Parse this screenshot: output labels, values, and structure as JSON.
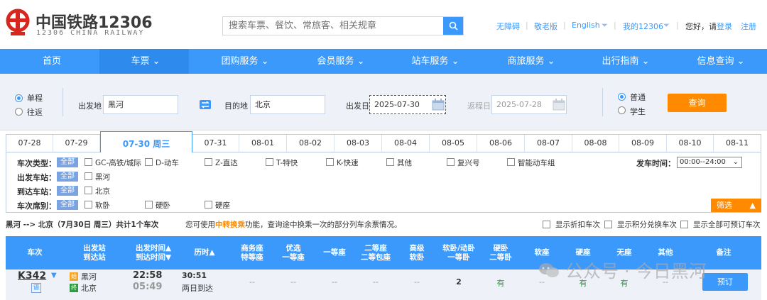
{
  "header": {
    "logo_cn": "中国铁路12306",
    "logo_en": "12306 CHINA RAILWAY",
    "search_placeholder": "搜索车票、餐饮、常旅客、相关规章",
    "links": [
      "无障碍",
      "敬老版",
      "English",
      "我的12306"
    ],
    "greeting": "您好，请",
    "login": "登录",
    "register": "注册"
  },
  "nav": [
    "首页",
    "车票",
    "团购服务",
    "会员服务",
    "站车服务",
    "商旅服务",
    "出行指南",
    "信息查询"
  ],
  "query": {
    "trip_types": [
      "单程",
      "往返"
    ],
    "from_label": "出发地",
    "from_value": "黑河",
    "to_label": "目的地",
    "to_value": "北京",
    "depart_label": "出发日",
    "depart_value": "2025-07-30",
    "return_label": "返程日",
    "return_value": "2025-07-28",
    "passenger_types": [
      "普通",
      "学生"
    ],
    "search_button": "查询"
  },
  "dates": [
    "07-28",
    "07-29",
    "07-30 周三",
    "07-31",
    "08-01",
    "08-02",
    "08-03",
    "08-04",
    "08-05",
    "08-06",
    "08-07",
    "08-08",
    "08-09",
    "08-10",
    "08-11"
  ],
  "filters": {
    "all_label": "全部",
    "train_type_title": "车次类型：",
    "train_types": [
      "GC-高铁/城际",
      "D-动车",
      "Z-直达",
      "T-特快",
      "K-快速",
      "其他",
      "复兴号",
      "智能动车组"
    ],
    "depart_station_title": "出发车站：",
    "depart_stations": [
      "黑河"
    ],
    "arrive_station_title": "到达车站：",
    "arrive_stations": [
      "北京"
    ],
    "seat_title": "车次席别：",
    "seats": [
      "软卧",
      "硬卧",
      "硬座"
    ],
    "time_title": "发车时间：",
    "time_value": "00:00--24:00",
    "filter_button": "筛选"
  },
  "summary": {
    "route": "黑河 --> 北京（7月30日 周三）共计",
    "count": "1",
    "route_suffix": "个车次",
    "hint_prefix": "您可使用",
    "hint_link": "中转换乘",
    "hint_suffix": "功能，查询途中换乘一次的部分列车余票情况。",
    "options": [
      "显示折扣车次",
      "显示积分兑换车次",
      "显示全部可预订车次"
    ]
  },
  "table_header": {
    "train": "车次",
    "stations_1": "出发站",
    "stations_2": "到达站",
    "times_1": "出发时间▲",
    "times_2": "到达时间▼",
    "duration": "历时▲",
    "business_1": "商务座",
    "business_2": "特等座",
    "premium_1": "优选",
    "premium_2": "一等座",
    "first": "一等座",
    "second_1": "二等座",
    "second_2": "二等包座",
    "deluxe_1": "高级",
    "deluxe_2": "软卧",
    "soft_sleeper_1": "软卧/动卧",
    "soft_sleeper_2": "一等卧",
    "hard_sleeper_1": "硬卧",
    "hard_sleeper_2": "二等卧",
    "soft_seat": "软座",
    "hard_seat": "硬座",
    "no_seat": "无座",
    "other": "其他",
    "remark": "备注"
  },
  "train": {
    "number": "K342",
    "tag": "谱",
    "from_badge": "始",
    "from": "黑河",
    "to_badge": "终",
    "to": "北京",
    "depart_time": "22:58",
    "arrive_time": "05:49",
    "duration": "30:51",
    "arrive_day": "两日到达",
    "cells": [
      "--",
      "--",
      "--",
      "--",
      "--",
      "2",
      "有",
      "--",
      "有",
      "有",
      "--"
    ],
    "book_button": "预订"
  },
  "watermark": "公众号 · 今日黑河",
  "colors": {
    "primary": "#3b99fc",
    "accent": "#ff8a00",
    "brand_red": "#d7261e",
    "available": "#2c9e3d"
  }
}
